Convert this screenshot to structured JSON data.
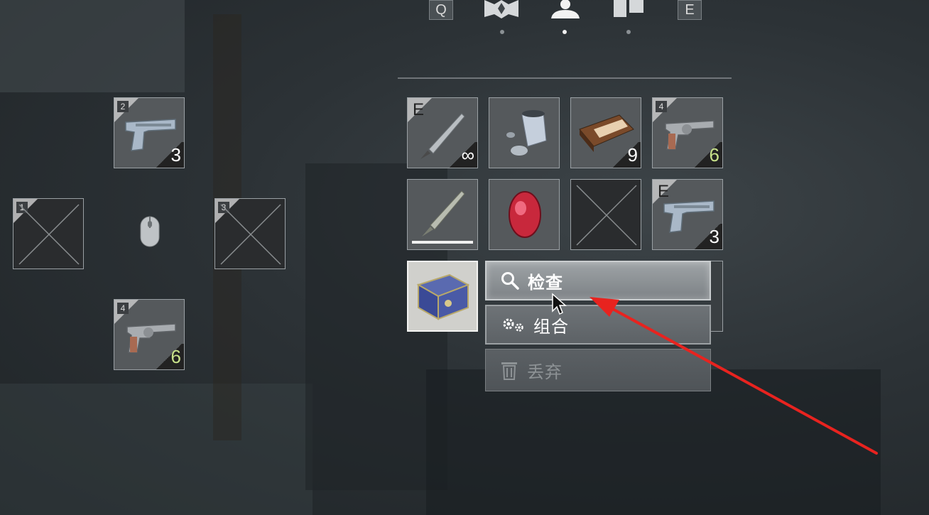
{
  "topnav": {
    "left_key": "Q",
    "right_key": "E",
    "tabs": [
      {
        "name": "map-icon",
        "active": false
      },
      {
        "name": "character-icon",
        "active": true
      },
      {
        "name": "files-icon",
        "active": false
      }
    ]
  },
  "shortcuts": {
    "up": {
      "key": "2",
      "count": "3",
      "item": "pistol-icon"
    },
    "left": {
      "key": "1",
      "empty": true
    },
    "right": {
      "key": "3",
      "empty": true
    },
    "down": {
      "key": "4",
      "count": "6",
      "item": "revolver-icon"
    }
  },
  "inventory": [
    {
      "tag": "E",
      "item": "knife-icon",
      "count": "∞"
    },
    {
      "item": "gunpowder-icon"
    },
    {
      "item": "ammo-box-icon",
      "count": "9"
    },
    {
      "tag": "4",
      "item": "revolver-icon",
      "count": "6"
    },
    {
      "item": "combat-knife-icon",
      "durability": 1.0
    },
    {
      "item": "red-gem-icon"
    },
    {
      "empty": true
    },
    {
      "tag": "E",
      "item": "pistol-icon",
      "count": "3"
    },
    {
      "item": "jewel-box-icon",
      "selected": true
    }
  ],
  "context_menu": {
    "items": [
      {
        "label": "检查",
        "icon": "magnifier-icon",
        "state": "hover"
      },
      {
        "label": "组合",
        "icon": "gears-icon",
        "state": "normal"
      },
      {
        "label": "丢弃",
        "icon": "trash-icon",
        "state": "disabled"
      }
    ]
  },
  "colors": {
    "annotation_arrow": "#e8231f",
    "count_green": "#c8e28a",
    "panel_border": "#9aa0a4"
  }
}
